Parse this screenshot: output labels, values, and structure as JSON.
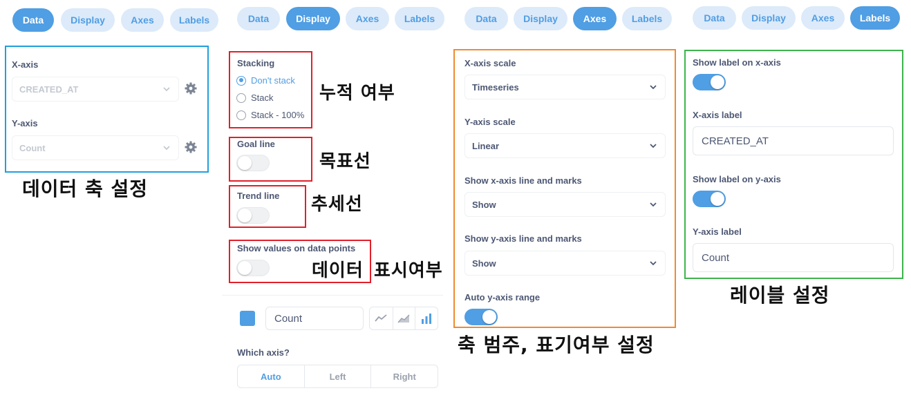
{
  "panels": [
    {
      "tabs": [
        "Data",
        "Display",
        "Axes",
        "Labels"
      ],
      "active": "Data"
    },
    {
      "tabs": [
        "Data",
        "Display",
        "Axes",
        "Labels"
      ],
      "active": "Display"
    },
    {
      "tabs": [
        "Data",
        "Display",
        "Axes",
        "Labels"
      ],
      "active": "Axes"
    },
    {
      "tabs": [
        "Data",
        "Display",
        "Axes",
        "Labels"
      ],
      "active": "Labels"
    }
  ],
  "data_panel": {
    "x_axis_label": "X-axis",
    "x_axis_value": "CREATED_AT",
    "y_axis_label": "Y-axis",
    "y_axis_value": "Count",
    "annotation": "데이터 축 설정"
  },
  "display_panel": {
    "stacking_label": "Stacking",
    "stacking_options": [
      "Don't stack",
      "Stack",
      "Stack - 100%"
    ],
    "stacking_selected": "Don't stack",
    "stacking_annotation": "누적 여부",
    "goal_line_label": "Goal line",
    "goal_line_annotation": "목표선",
    "trend_line_label": "Trend line",
    "trend_line_annotation": "추세선",
    "show_values_label": "Show values on data points",
    "show_values_annotation_1": "데이터",
    "show_values_annotation_2": "표시여부",
    "series_name": "Count",
    "which_axis_label": "Which axis?",
    "axis_options": [
      "Auto",
      "Left",
      "Right"
    ],
    "axis_selected": "Auto"
  },
  "axes_panel": {
    "x_scale_label": "X-axis scale",
    "x_scale_value": "Timeseries",
    "y_scale_label": "Y-axis scale",
    "y_scale_value": "Linear",
    "show_x_line_label": "Show x-axis line and marks",
    "show_x_line_value": "Show",
    "show_y_line_label": "Show y-axis line and marks",
    "show_y_line_value": "Show",
    "auto_range_label": "Auto y-axis range",
    "annotation": "축 범주, 표기여부 설정"
  },
  "labels_panel": {
    "show_x_label": "Show label on x-axis",
    "x_label_title": "X-axis label",
    "x_label_value": "CREATED_AT",
    "show_y_label": "Show label on y-axis",
    "y_label_title": "Y-axis label",
    "y_label_value": "Count",
    "annotation": "레이블 설정"
  },
  "colors": {
    "accent": "#509ee3",
    "tab_inactive_bg": "#dceafa",
    "box_blue": "#1ea0dc",
    "box_red": "#e0202a",
    "box_orange": "#f08a2e",
    "box_green": "#3cb44b"
  }
}
